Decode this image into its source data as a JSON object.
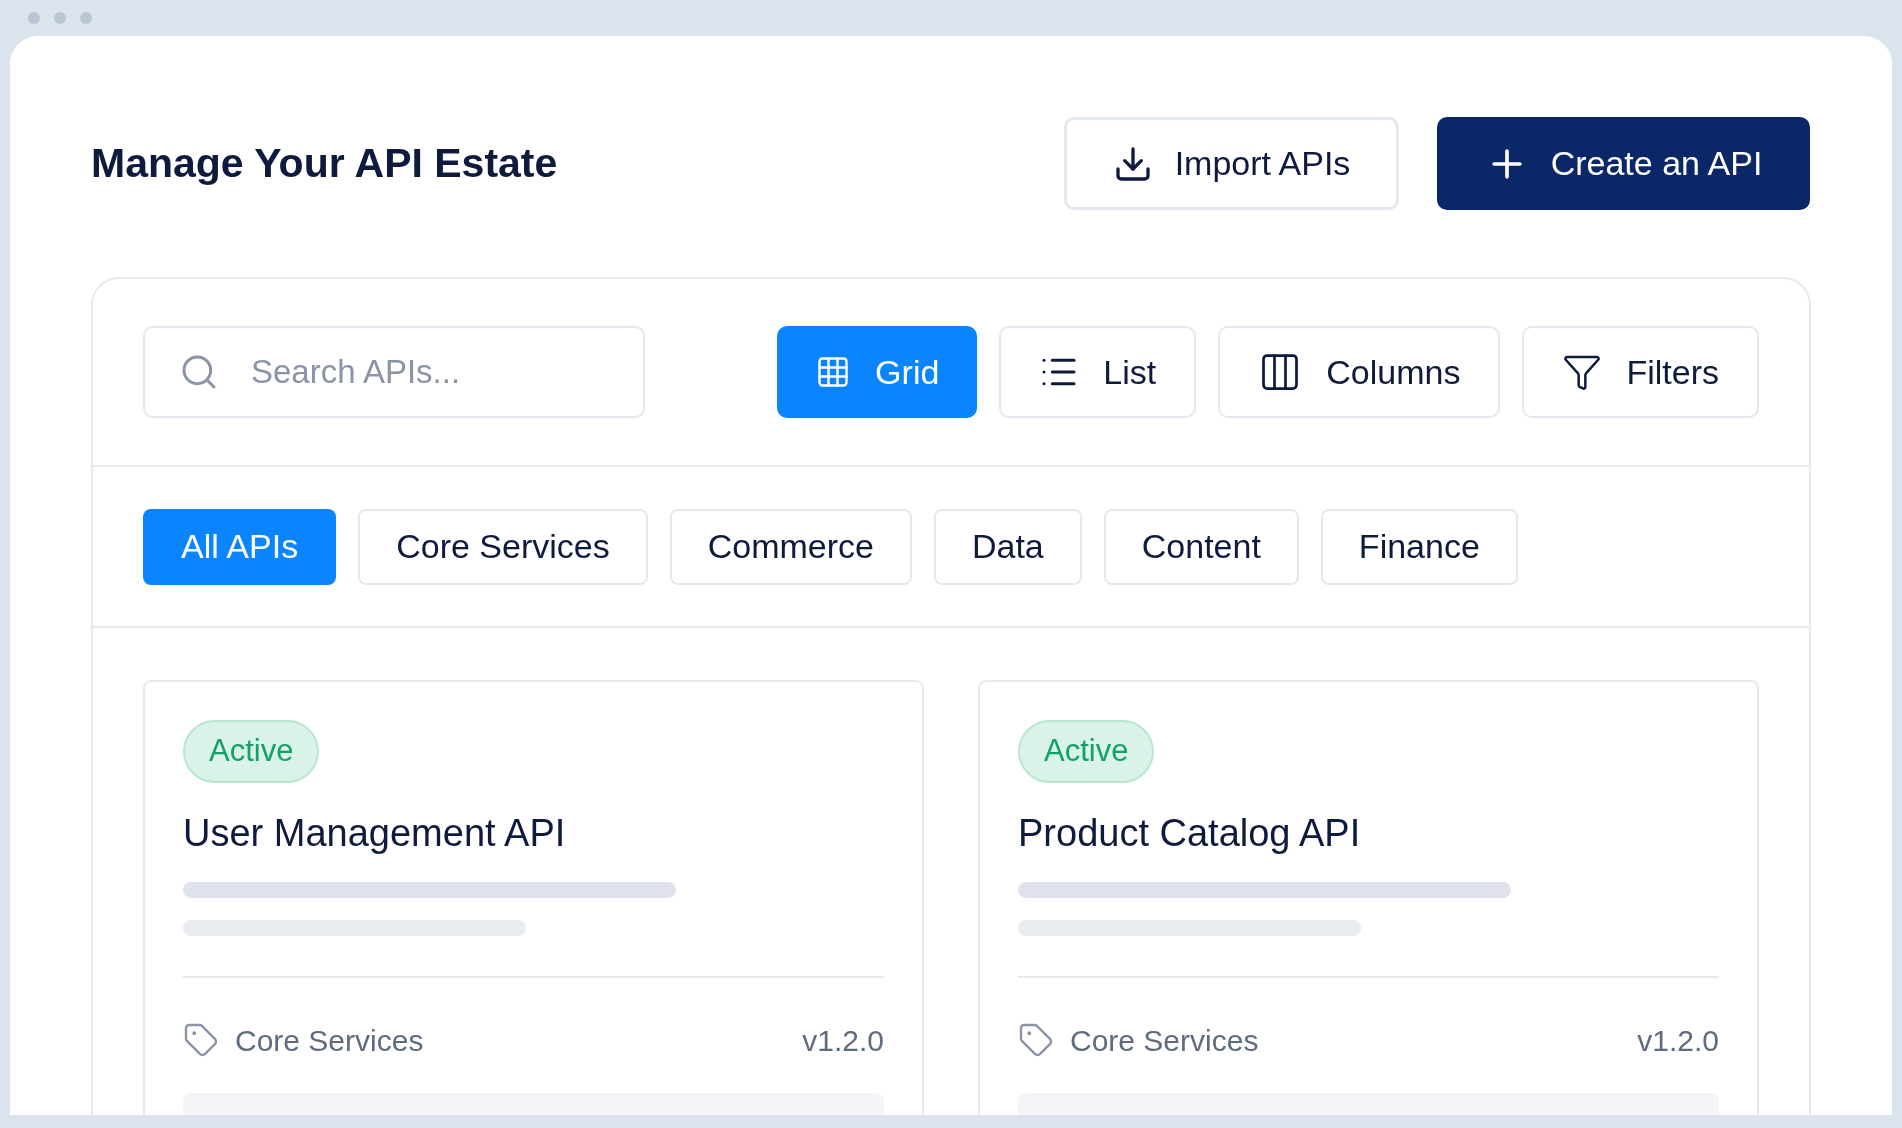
{
  "header": {
    "title": "Manage Your API Estate",
    "actions": [
      {
        "label": "Import APIs",
        "kind": "secondary"
      },
      {
        "label": "Create an API",
        "kind": "primary"
      }
    ]
  },
  "search": {
    "placeholder": "Search APIs..."
  },
  "views": [
    {
      "label": "Grid",
      "kind": "grid",
      "selected": true
    },
    {
      "label": "List",
      "kind": "list",
      "selected": false
    },
    {
      "label": "Columns",
      "kind": "columns",
      "selected": false
    },
    {
      "label": "Filters",
      "kind": "filters",
      "selected": false
    }
  ],
  "categories": [
    {
      "label": "All APIs",
      "selected": true
    },
    {
      "label": "Core Services",
      "selected": false
    },
    {
      "label": "Commerce",
      "selected": false
    },
    {
      "label": "Data",
      "selected": false
    },
    {
      "label": "Content",
      "selected": false
    },
    {
      "label": "Finance",
      "selected": false
    }
  ],
  "cards": [
    {
      "status": "Active",
      "title": "User Management API",
      "category": "Core Services",
      "version": "v1.2.0"
    },
    {
      "status": "Active",
      "title": "Product Catalog API",
      "category": "Core Services",
      "version": "v1.2.0"
    }
  ]
}
